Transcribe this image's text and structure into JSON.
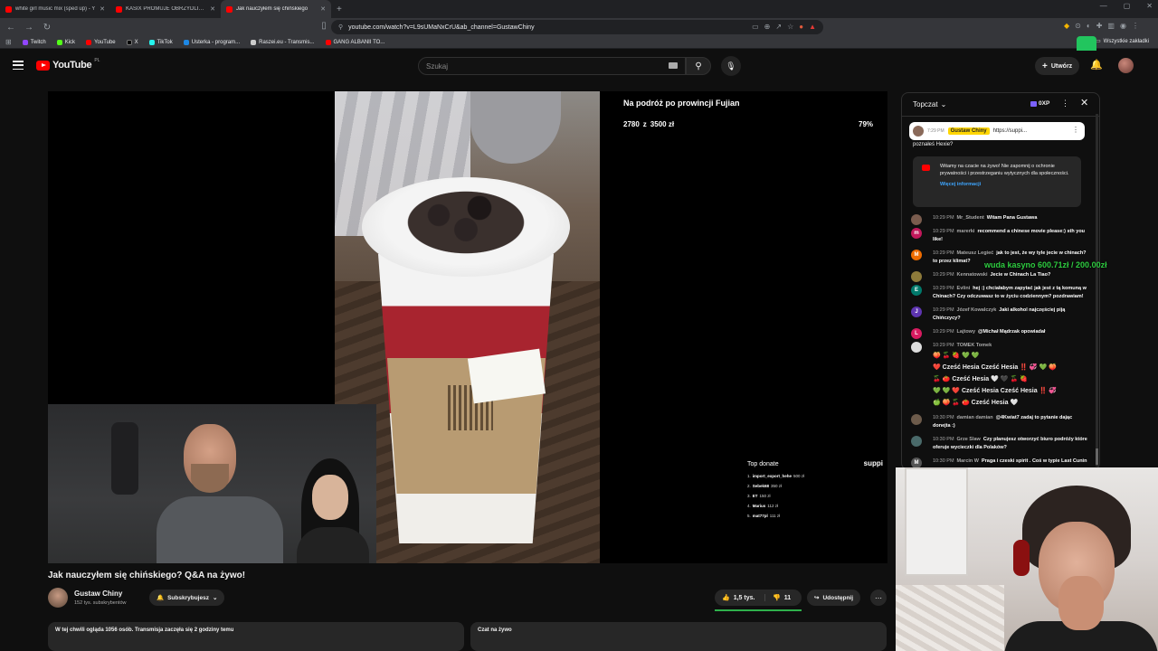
{
  "browser": {
    "tabs": [
      {
        "title": "white girl music mix (sped up) - Y",
        "active": false
      },
      {
        "title": "KASIX PROMUJE OBRZYDLIWY SCAM",
        "active": false
      },
      {
        "title": "Jak nauczyłem się chińskiego",
        "active": true
      }
    ],
    "url": "youtube.com/watch?v=L9sUMaNxCrU&ab_channel=GustawChiny",
    "bookmarks": [
      "Twitch",
      "Kick",
      "YouTube",
      "X",
      "TikTok",
      "Usterka - program...",
      "Raszei.eu - Transmis...",
      "GANG ALBANII TO..."
    ],
    "all_bookmarks": "Wszystkie zakładki"
  },
  "youtube": {
    "logo_text": "YouTube",
    "region": "PL",
    "search_placeholder": "Szukaj",
    "create_label": "Utwórz"
  },
  "video": {
    "overlay_title": "Na podróż po prowincji Fujian",
    "goal_current": "2780",
    "goal_sep": "z",
    "goal_target": "3500 zł",
    "goal_percent": "79%",
    "top_donate_header": "Top donate",
    "top_donate_brand": "suppi",
    "top_donate": [
      {
        "rank": "1.",
        "name": "import_export_hehe",
        "amount": "500 zł"
      },
      {
        "rank": "2.",
        "name": "Sebek68",
        "amount": "350 zł"
      },
      {
        "rank": "3.",
        "name": "ET",
        "amount": "150 zł"
      },
      {
        "rank": "4.",
        "name": "Marius",
        "amount": "112 zł"
      },
      {
        "rank": "5.",
        "name": "mat77pl",
        "amount": "111 zł"
      }
    ],
    "title": "Jak nauczyłem się chińskiego? Q&A na żywo!",
    "channel_name": "Gustaw Chiny",
    "channel_subs": "152 tys. subskrybentów",
    "subscribed_label": "Subskrybujesz",
    "likes": "1,5 tys.",
    "dislikes": "11",
    "share_label": "Udostępnij",
    "desc_preview": "W tej chwili ogląda 1056 osób. Transmisja zaczęła się 2 godziny temu",
    "chat_preview": "Czat na żywo"
  },
  "chat": {
    "mode": "Topczat",
    "points": "0XP",
    "pinned": {
      "time": "7:29 PM",
      "author": "Gustaw Chiny",
      "text": "https://suppi..."
    },
    "peek_text": "poznałeś Hexie?",
    "welcome_text": "Witamy na czacie na żywo! Nie zapomnij o ochronie prywatności i przestrzeganiu wytycznych dla społeczności.",
    "welcome_link": "Więcej informacji",
    "messages": [
      {
        "time": "10:29 PM",
        "author": "Mr_Student",
        "text": "Witam Pana Gustawa",
        "avatar": "",
        "color": "#7a5c4e"
      },
      {
        "time": "10:29 PM",
        "author": "marerki",
        "text": "recommend a chinese movie please:) sth you like!",
        "avatar": "m",
        "color": "#c2185b"
      },
      {
        "time": "10:29 PM",
        "author": "Mateusz Legieć",
        "text": "jak to jest, że wy tyle jecie w chinach? to przez klimat?",
        "avatar": "M",
        "color": "#ef6c00"
      },
      {
        "time": "10:29 PM",
        "author": "Kennatowski",
        "text": "Jecie w Chinach La Tiao?",
        "avatar": "",
        "color": "#8d7a3a"
      },
      {
        "time": "10:29 PM",
        "author": "Evlini",
        "text": "hej :) chciałabym zapytać jak jest z tą komuną w Chinach? Czy odczuwasz to w życiu codziennym? pozdrawiam!",
        "avatar": "E",
        "color": "#00796b"
      },
      {
        "time": "10:29 PM",
        "author": "Józef Kowalczyk",
        "text": "Jaki alkohol najczęściej piją Chińczycy?",
        "avatar": "J",
        "color": "#5e35b1"
      },
      {
        "time": "10:29 PM",
        "author": "Lajtowy",
        "text": "@Michał Mądrzak opowiadał",
        "avatar": "L",
        "color": "#d81b60"
      },
      {
        "time": "10:30 PM",
        "author": "damian damian",
        "text": "@4Kwiat7 zadaj to pytanie dając donejta :)",
        "avatar": "",
        "color": "#6d5b4b"
      },
      {
        "time": "10:30 PM",
        "author": "Grze Slaw",
        "text": "Czy planujesz otworzyć biuro podróży które oferuje wycieczki dla Polaków?",
        "avatar": "",
        "color": "#4a6a6a"
      },
      {
        "time": "10:30 PM",
        "author": "Marcin W",
        "text": "Praga i czeski spirit . Coś w typie Last Cunin",
        "avatar": "M",
        "color": "#555"
      }
    ],
    "emoji_message": {
      "time": "10:29 PM",
      "author": "TOMEK Tomek",
      "lines": [
        "🍑 🍒 🍓 💚 💚",
        "❤️ Cześć Hesia Cześć Hesia ‼️ 💞 💚 🍑",
        "🍒 🍅 Cześć Hesia 🤍 🖤 🍒 🍓",
        "💚 💚 ❤️ Cześć Hesia Cześć Hesia ‼️ 💞",
        "🍏 🍑 🍒 🍅 Cześć Hesia 🤍"
      ]
    },
    "wager_overlay": "wuda kasyno 600.71zł / 200.00zł"
  },
  "colors": {
    "accent_red": "#ff0000",
    "like_bar": "#2fb04c",
    "pinned_highlight": "#ffd600",
    "link_blue": "#3ea6ff",
    "wager_green": "#2ecc40"
  }
}
